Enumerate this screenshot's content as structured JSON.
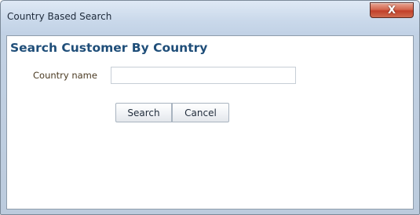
{
  "window": {
    "title": "Country Based Search",
    "close_icon": "close-icon",
    "close_glyph": "X"
  },
  "form": {
    "heading": "Search Customer By Country",
    "country_label": "Country name",
    "country_value": "",
    "country_placeholder": ""
  },
  "buttons": {
    "search_label": "Search",
    "cancel_label": "Cancel"
  },
  "colors": {
    "heading": "#1f4e79",
    "label": "#4a3a22",
    "close_button": "#c2402a"
  }
}
